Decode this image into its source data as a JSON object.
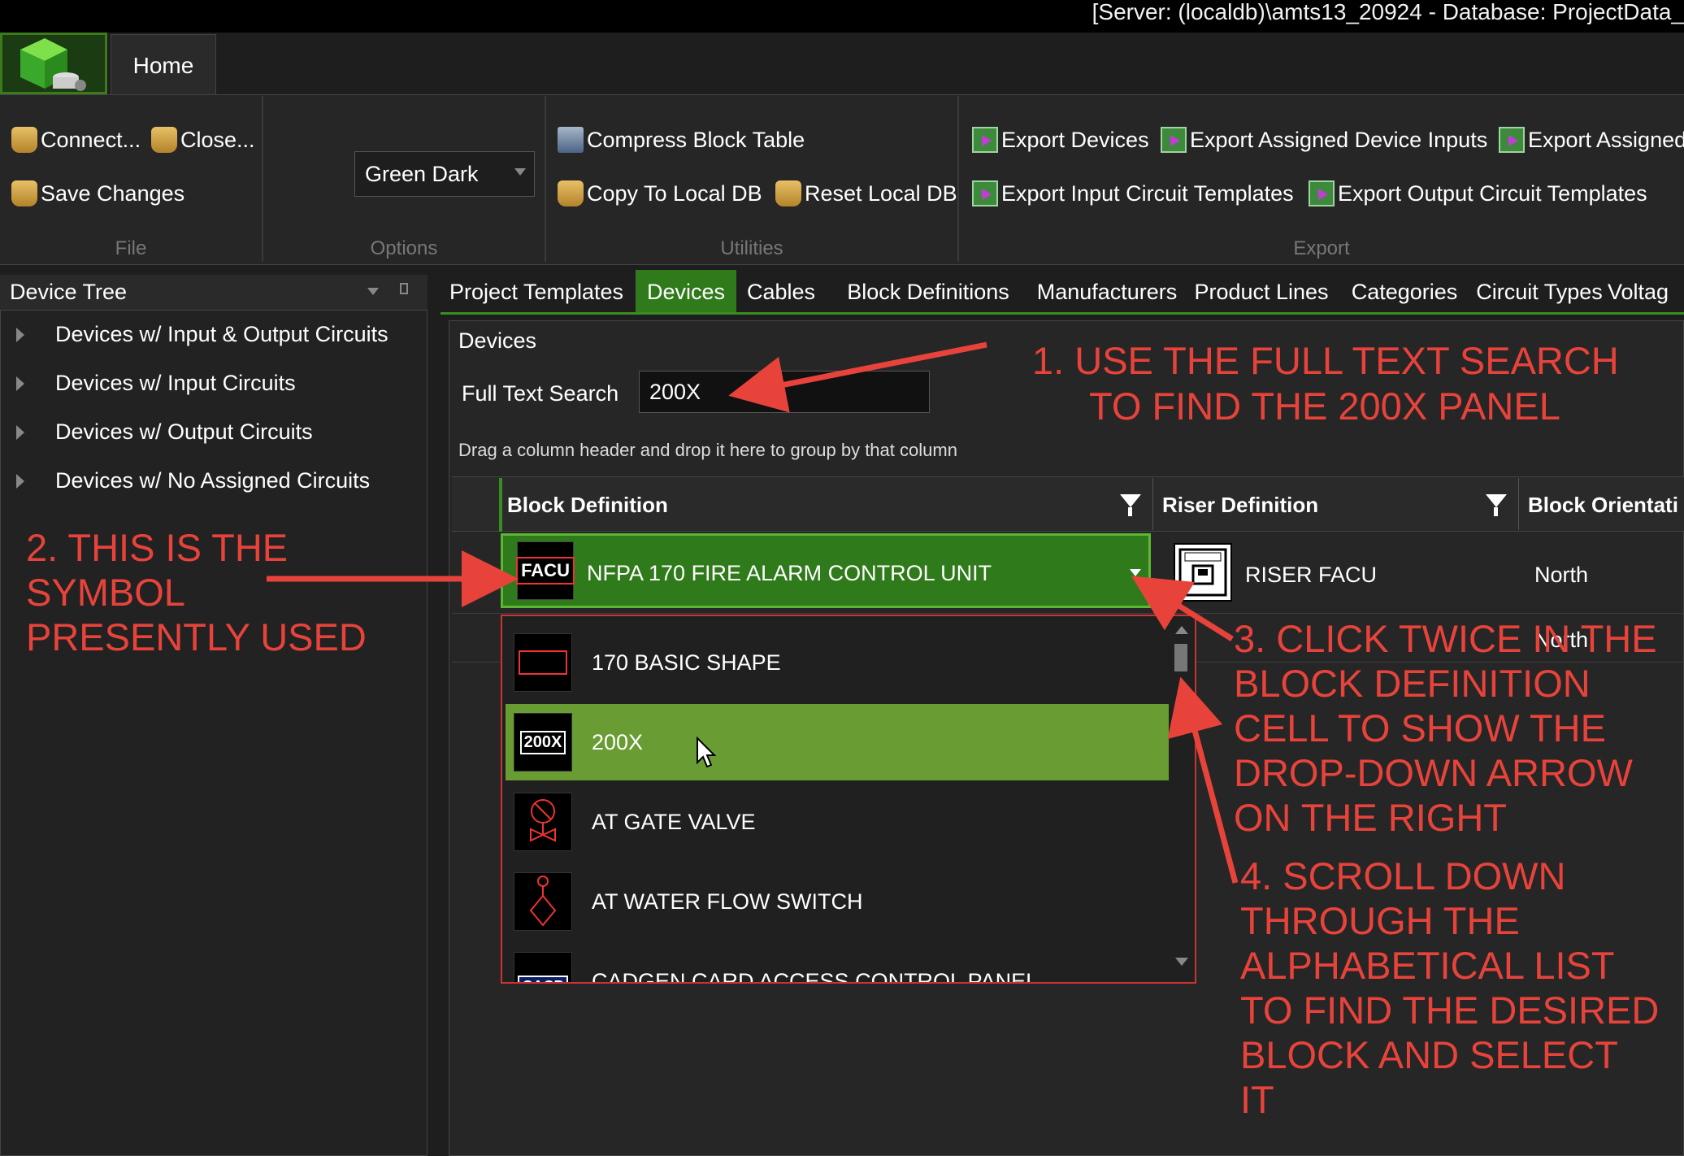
{
  "window": {
    "title": "[Server: (localdb)\\amts13_20924 - Database: ProjectData_"
  },
  "ribbon": {
    "home_tab": "Home",
    "file": {
      "connect": "Connect...",
      "close": "Close...",
      "save": "Save Changes",
      "label": "File"
    },
    "options": {
      "theme": "Green Dark",
      "label": "Options"
    },
    "utilities": {
      "compress": "Compress Block Table",
      "copy": "Copy To Local DB",
      "reset": "Reset Local DB",
      "label": "Utilities"
    },
    "export": {
      "devices": "Export Devices",
      "assigned_inputs": "Export Assigned Device Inputs",
      "assigned_more": "Export Assigned",
      "input_templates": "Export Input Circuit Templates",
      "output_templates": "Export Output Circuit Templates",
      "label": "Export"
    }
  },
  "tree": {
    "title": "Device Tree",
    "items": [
      "Devices w/ Input & Output Circuits",
      "Devices w/ Input Circuits",
      "Devices w/ Output Circuits",
      "Devices w/ No Assigned Circuits"
    ]
  },
  "tabs": [
    "Project Templates",
    "Devices",
    "Cables",
    "Block Definitions",
    "Manufacturers",
    "Product Lines",
    "Categories",
    "Circuit Types",
    "Voltag"
  ],
  "devices": {
    "title": "Devices",
    "search_label": "Full Text Search",
    "search_value": "200X",
    "group_hint": "Drag a column header and drop it here to group by that column",
    "columns": [
      "Block Definition",
      "Riser Definition",
      "Block Orientati"
    ],
    "row1": {
      "block_thumb": "FACU",
      "block": "NFPA 170 FIRE ALARM CONTROL UNIT",
      "riser": "RISER FACU",
      "orientation": "North"
    },
    "row2": {
      "orientation": "North"
    }
  },
  "dropdown": {
    "items": [
      {
        "label": "170 BASIC SHAPE"
      },
      {
        "label": "200X",
        "thumb": "200X"
      },
      {
        "label": "AT GATE VALVE"
      },
      {
        "label": "AT WATER FLOW SWITCH"
      },
      {
        "label": "CADGEN CARD ACCESS CONTROL PANEL",
        "thumb": "CACP"
      }
    ]
  },
  "annotations": {
    "a1_line1": "1. USE THE FULL TEXT SEARCH",
    "a1_line2": "TO FIND THE 200X PANEL",
    "a2_line1": "2. THIS IS THE",
    "a2_line2": "SYMBOL",
    "a2_line3": "PRESENTLY USED",
    "a3_line1": "3. CLICK TWICE IN THE",
    "a3_line2": "BLOCK DEFINITION",
    "a3_line3": "CELL TO SHOW THE",
    "a3_line4": "DROP-DOWN ARROW",
    "a3_line5": "ON THE RIGHT",
    "a4_line1": "4. SCROLL DOWN",
    "a4_line2": "THROUGH THE",
    "a4_line3": "ALPHABETICAL LIST",
    "a4_line4": "TO FIND THE DESIRED",
    "a4_line5": "BLOCK AND SELECT",
    "a4_line6": "IT"
  },
  "colors": {
    "accent": "#2f7a1a",
    "annotation": "#e8433b",
    "selection": "#6a9c34"
  }
}
